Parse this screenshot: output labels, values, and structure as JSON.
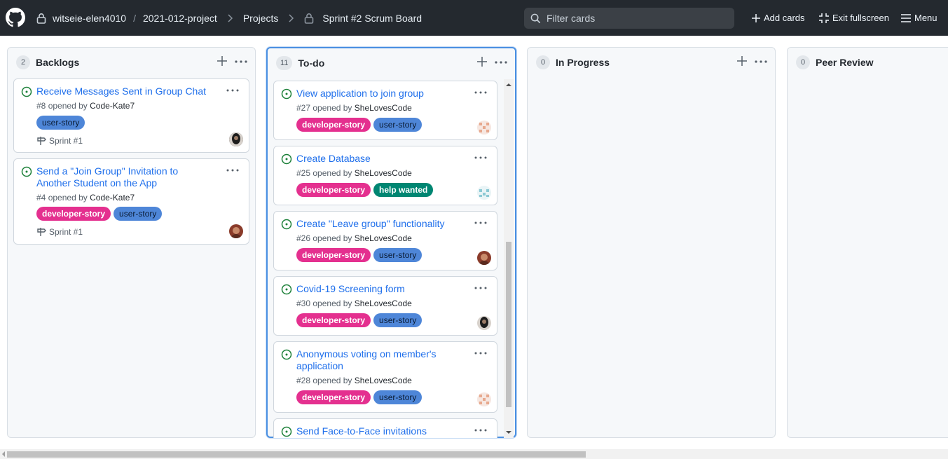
{
  "header": {
    "owner": "witseie-elen4010",
    "repo": "2021-012-project",
    "projects": "Projects",
    "board": "Sprint #2 Scrum Board",
    "filter_placeholder": "Filter cards",
    "add_cards": "Add cards",
    "exit_fullscreen": "Exit fullscreen",
    "menu": "Menu"
  },
  "columns": [
    {
      "title": "Backlogs",
      "count": "2",
      "cards": [
        {
          "title": "Receive Messages Sent in Group Chat",
          "number": "#8",
          "opened_by": "opened by",
          "author": "Code-Kate7",
          "labels": [
            "user-story"
          ],
          "milestone": "Sprint #1"
        },
        {
          "title_line1": "Send a \"Join Group\" Invitation to",
          "title_line2": "Another Student on the App",
          "number": "#4",
          "opened_by": "opened by",
          "author": "Code-Kate7",
          "labels": [
            "developer-story",
            "user-story"
          ],
          "milestone": "Sprint #1"
        }
      ]
    },
    {
      "title": "To-do",
      "count": "11",
      "cards": [
        {
          "title": "View application to join group",
          "number": "#27",
          "opened_by": "opened by",
          "author": "SheLovesCode",
          "labels": [
            "developer-story",
            "user-story"
          ]
        },
        {
          "title": "Create Database",
          "number": "#25",
          "opened_by": "opened by",
          "author": "SheLovesCode",
          "labels": [
            "developer-story",
            "help wanted"
          ]
        },
        {
          "title": "Create \"Leave group\" functionality",
          "number": "#26",
          "opened_by": "opened by",
          "author": "SheLovesCode",
          "labels": [
            "developer-story",
            "user-story"
          ]
        },
        {
          "title": "Covid-19 Screening form",
          "number": "#30",
          "opened_by": "opened by",
          "author": "SheLovesCode",
          "labels": [
            "developer-story",
            "user-story"
          ]
        },
        {
          "title_line1": "Anonymous voting on member's",
          "title_line2": "application",
          "number": "#28",
          "opened_by": "opened by",
          "author": "SheLovesCode",
          "labels": [
            "developer-story",
            "user-story"
          ]
        },
        {
          "title": "Send Face-to-Face invitations"
        }
      ]
    },
    {
      "title": "In Progress",
      "count": "0",
      "cards": []
    },
    {
      "title": "Peer Review",
      "count": "0",
      "cards": []
    }
  ],
  "colors": {
    "header_bg": "#24292f",
    "link": "#1f6feb",
    "label_developer_story": "#e4308f",
    "label_user_story": "#4e86d8",
    "label_help_wanted": "#008672",
    "open_issue": "#1a7f37"
  }
}
